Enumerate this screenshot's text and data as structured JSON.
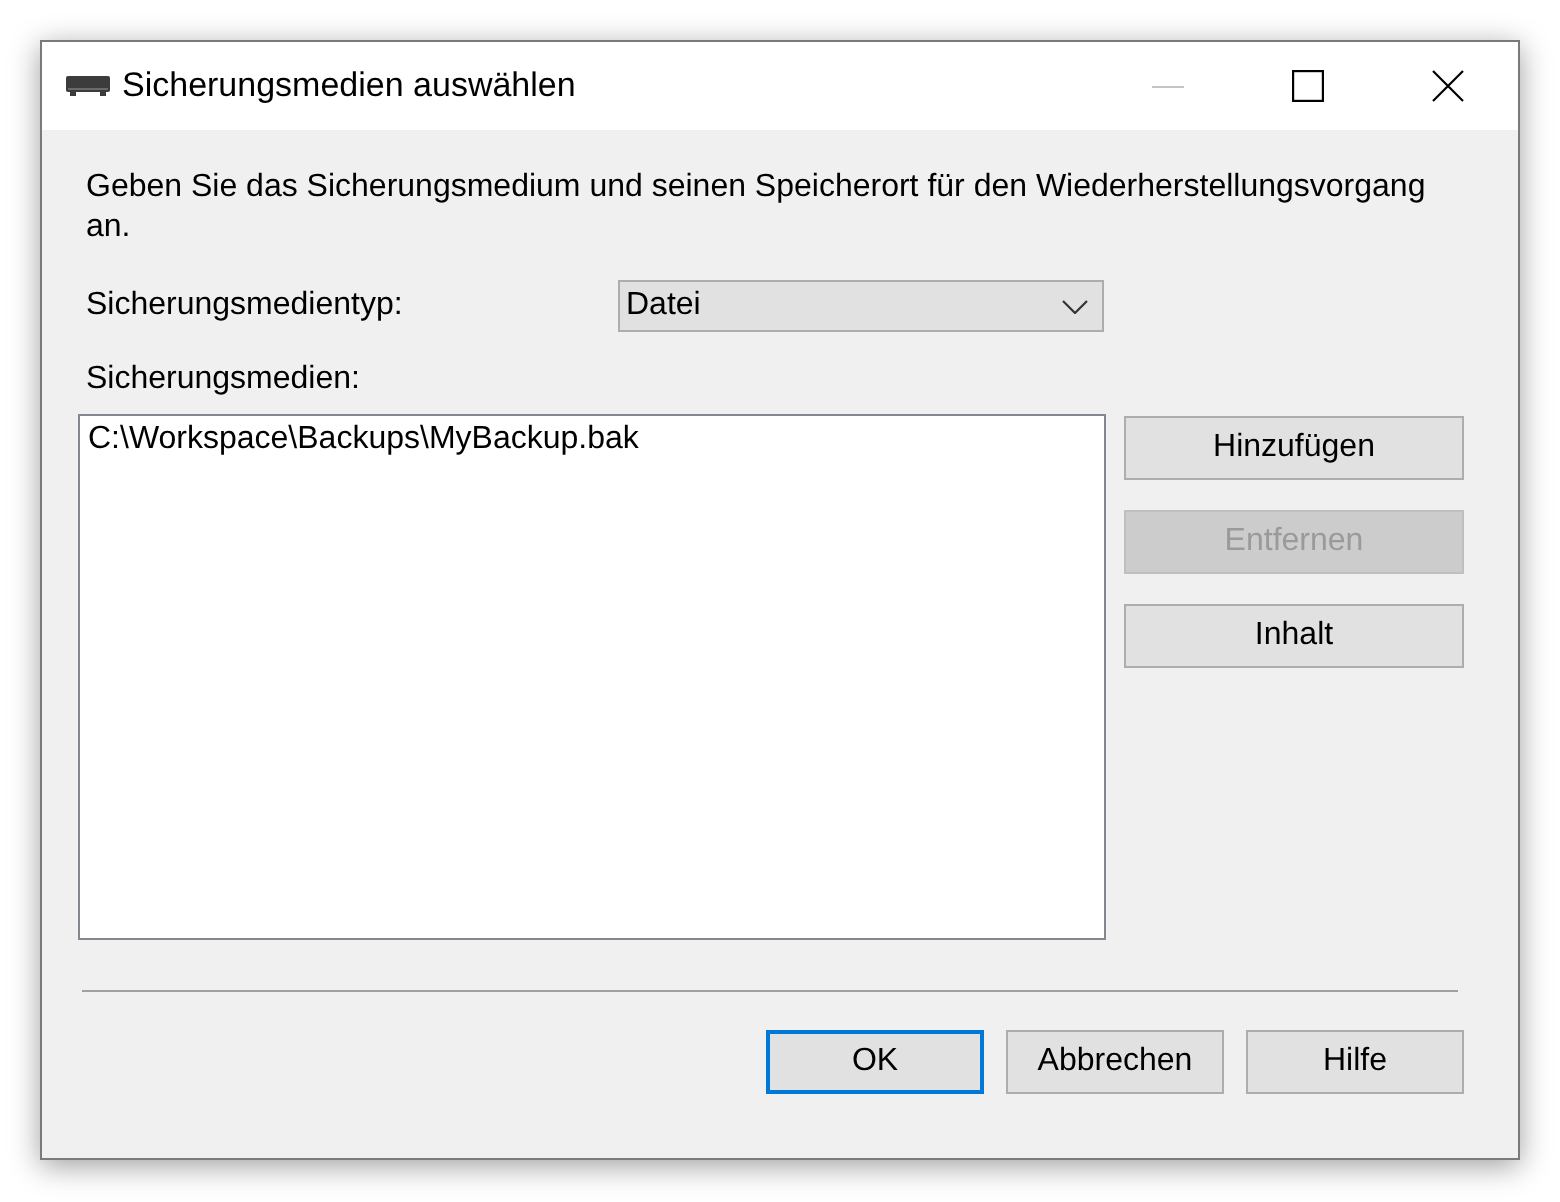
{
  "window": {
    "title": "Sicherungsmedien auswählen",
    "buttons": [
      {
        "kind": "minimize",
        "disabled": true
      },
      {
        "kind": "maximize",
        "disabled": false
      },
      {
        "kind": "close",
        "disabled": false
      }
    ]
  },
  "description": "Geben Sie das Sicherungsmedium und seinen Speicherort für den Wiederherstellungsvorgang an.",
  "media_type": {
    "label": "Sicherungsmedientyp:",
    "value": "Datei"
  },
  "media_list": {
    "label": "Sicherungsmedien:",
    "items": [
      {
        "text": "C:\\Workspace\\Backups\\MyBackup.bak",
        "selected": false
      }
    ]
  },
  "side_buttons": [
    {
      "label": "Hinzufügen",
      "disabled": false
    },
    {
      "label": "Entfernen",
      "disabled": true
    },
    {
      "label": "Inhalt",
      "disabled": false
    }
  ],
  "footer_buttons": [
    {
      "label": "OK",
      "default": true
    },
    {
      "label": "Abbrechen",
      "default": false
    },
    {
      "label": "Hilfe",
      "default": false
    }
  ]
}
